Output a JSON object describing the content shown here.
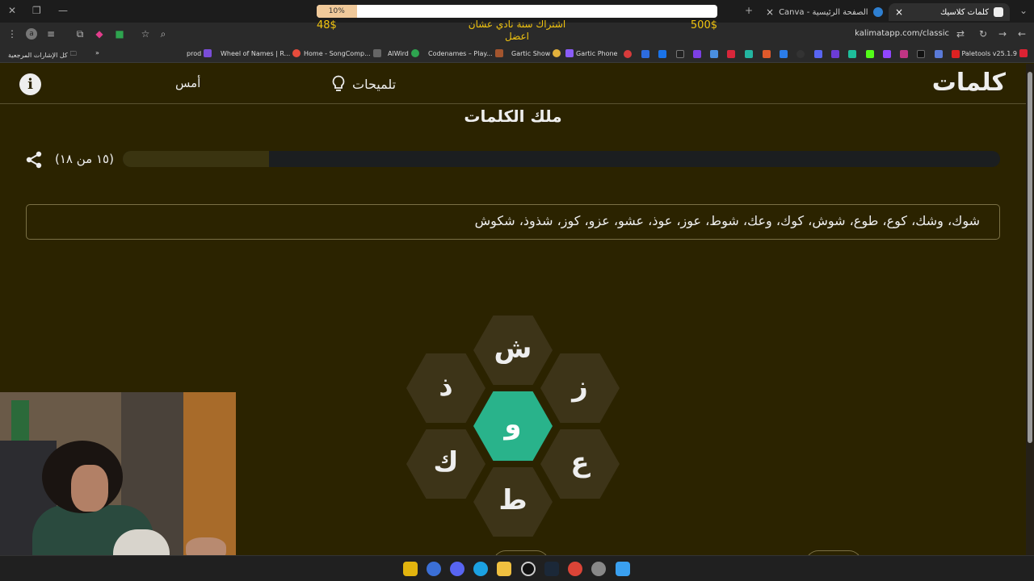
{
  "browser": {
    "tabs": [
      {
        "title": "كلمات كلاسيك",
        "close": "×"
      },
      {
        "title": "Canva - الصفحة الرئيسية",
        "close": "×"
      }
    ],
    "new_tab": "+",
    "url": "kalimatapp.com/classic",
    "bookmarks": [
      {
        "label": "Paletools v25.1.9"
      },
      {
        "label": "Gartic Phone"
      },
      {
        "label": "Gartic Show"
      },
      {
        "label": "Codenames – Play..."
      },
      {
        "label": "AlWird"
      },
      {
        "label": "Home - SongComp..."
      },
      {
        "label": "Wheel of Names | R..."
      },
      {
        "label": "prod"
      },
      {
        "label": "كل الإشارات المرجعية"
      }
    ],
    "bookmarks_more": "»"
  },
  "promo": {
    "progress_label": "10%",
    "progress": 0.1,
    "left_amount": "48$",
    "right_amount": "500$",
    "message_line1": "اشتراك سنة نادي عشان",
    "message_line2": "اعضل"
  },
  "header": {
    "logo": "كلمات",
    "hints_label": "تلميحات",
    "yesterday_label": "أمس",
    "info_label": "i"
  },
  "game": {
    "rank_title": "ملك الكلمات",
    "found_count": "(١٥ من ١٨)",
    "progress": 0.833,
    "found_words": "شوك، وشك، كوع، طوع، شوش، كوك، وعك، شوط، عوز، عوذ، عشو، عزو، كوز، شذوذ، شكوش",
    "letters": {
      "center": "و",
      "top": "ش",
      "top_right": "ز",
      "bottom_right": "ع",
      "bottom": "ط",
      "bottom_left": "ك",
      "top_left": "ذ"
    }
  }
}
